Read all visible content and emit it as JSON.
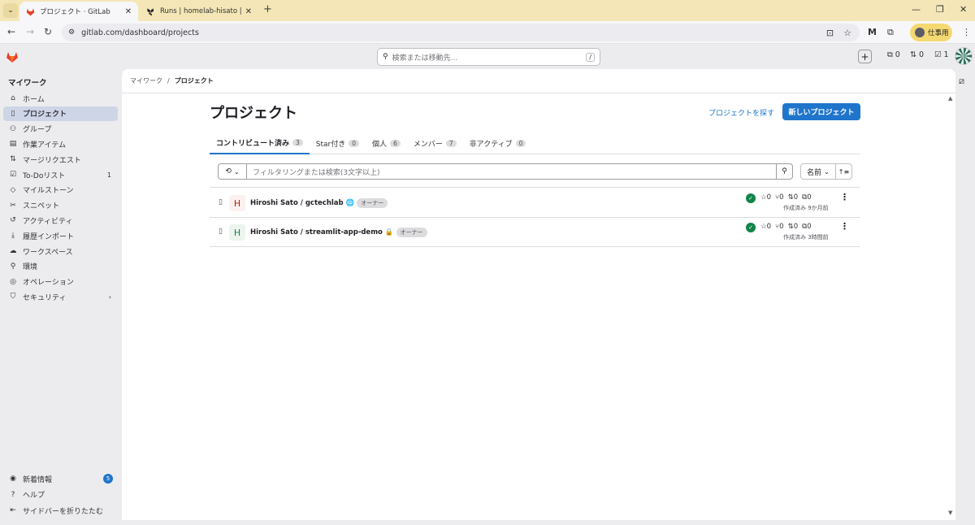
{
  "browser": {
    "tabs": [
      {
        "title": "プロジェクト · GitLab",
        "active": true
      },
      {
        "title": "Runs | homelab-hisato | HCP Te",
        "active": false
      }
    ],
    "url": "gitlab.com/dashboard/projects",
    "profile_label": "仕事用"
  },
  "header": {
    "search_placeholder": "検索または移動先...",
    "search_shortcut": "/",
    "issues_count": "0",
    "mr_count": "0",
    "todo_count": "1"
  },
  "sidebar": {
    "title": "マイワーク",
    "items": [
      {
        "label": "ホーム",
        "icon": "home-icon",
        "glyph": "⌂"
      },
      {
        "label": "プロジェクト",
        "icon": "project-icon",
        "glyph": "▯",
        "active": true
      },
      {
        "label": "グループ",
        "icon": "group-icon",
        "glyph": "⚇"
      },
      {
        "label": "作業アイテム",
        "icon": "work-items-icon",
        "glyph": "▤"
      },
      {
        "label": "マージリクエスト",
        "icon": "merge-request-icon",
        "glyph": "⇅"
      },
      {
        "label": "To-Doリスト",
        "icon": "todo-icon",
        "glyph": "☑",
        "count": "1"
      },
      {
        "label": "マイルストーン",
        "icon": "milestone-icon",
        "glyph": "◇"
      },
      {
        "label": "スニペット",
        "icon": "snippet-icon",
        "glyph": "✂"
      },
      {
        "label": "アクティビティ",
        "icon": "activity-icon",
        "glyph": "↺"
      },
      {
        "label": "履歴インポート",
        "icon": "import-icon",
        "glyph": "⤓"
      },
      {
        "label": "ワークスペース",
        "icon": "workspace-icon",
        "glyph": "☁"
      },
      {
        "label": "環境",
        "icon": "environment-icon",
        "glyph": "⚲"
      },
      {
        "label": "オペレーション",
        "icon": "operations-icon",
        "glyph": "◎"
      },
      {
        "label": "セキュリティ",
        "icon": "security-icon",
        "glyph": "⛉"
      }
    ],
    "footer": [
      {
        "label": "新着情報",
        "icon": "compass-icon",
        "glyph": "◉",
        "badge": "5"
      },
      {
        "label": "ヘルプ",
        "icon": "help-icon",
        "glyph": "?"
      },
      {
        "label": "サイドバーを折りたたむ",
        "icon": "collapse-sidebar-icon",
        "glyph": "⇤"
      }
    ]
  },
  "breadcrumb": {
    "parent": "マイワーク",
    "separator": "/",
    "current": "プロジェクト"
  },
  "page": {
    "title": "プロジェクト",
    "explore_link": "プロジェクトを探す",
    "new_button": "新しいプロジェクト"
  },
  "tabs": [
    {
      "label": "コントリビュート済み",
      "count": "3",
      "active": true
    },
    {
      "label": "Star付き",
      "count": "0"
    },
    {
      "label": "個人",
      "count": "6"
    },
    {
      "label": "メンバー",
      "count": "7"
    },
    {
      "label": "非アクティブ",
      "count": "0"
    }
  ],
  "filter": {
    "placeholder": "フィルタリングまたは検索(3文字以上)",
    "sort_label": "名前"
  },
  "projects": [
    {
      "avatar_letter": "H",
      "avatar_color": "#fcf1ef",
      "avatar_text_color": "#c91c00",
      "name": "Hiroshi Sato / gctechlab",
      "visibility_glyph": "🌐",
      "role": "オーナー",
      "stars": "0",
      "forks": "0",
      "mrs": "0",
      "issues": "0",
      "created": "作成済み 9か月前"
    },
    {
      "avatar_letter": "H",
      "avatar_color": "#ecf4ee",
      "avatar_text_color": "#108548",
      "name": "Hiroshi Sato / streamlit-app-demo",
      "visibility_glyph": "🔒",
      "role": "オーナー",
      "stars": "0",
      "forks": "0",
      "mrs": "0",
      "issues": "0",
      "created": "作成済み 3時間前"
    }
  ]
}
